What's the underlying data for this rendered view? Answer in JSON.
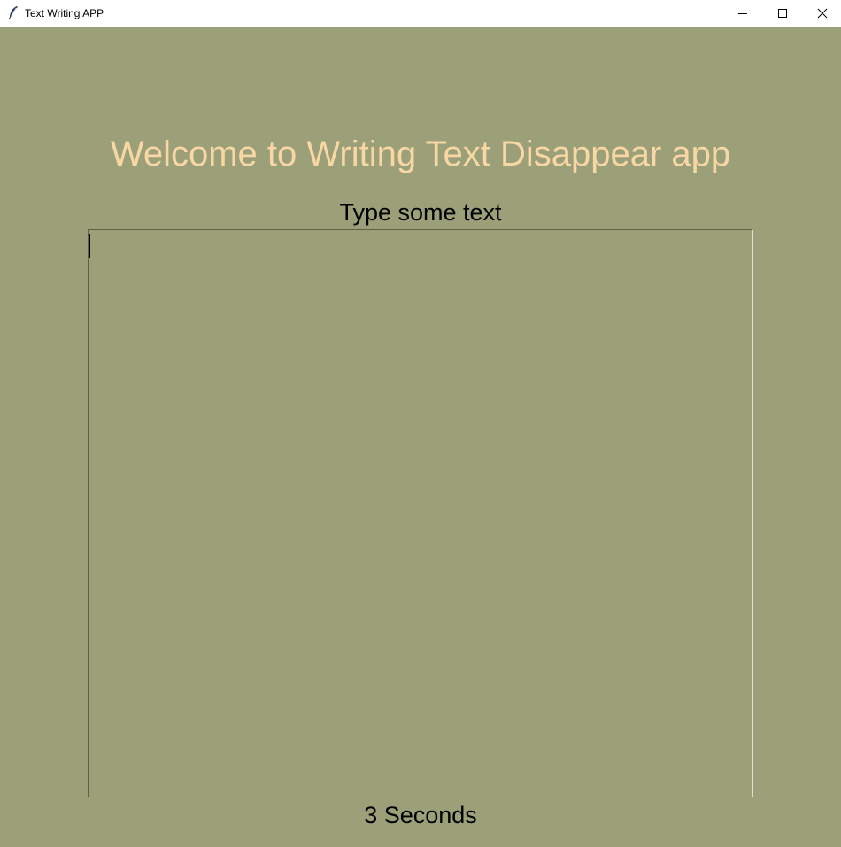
{
  "window": {
    "title": "Text Writing APP",
    "app_icon": "feather-icon",
    "controls": {
      "minimize": "minimize-icon",
      "maximize": "maximize-icon",
      "close": "close-icon"
    }
  },
  "main": {
    "welcome_text": "Welcome to Writing Text Disappear app",
    "prompt_label": "Type some text",
    "text_value": "",
    "timer_label": "3 Seconds"
  },
  "colors": {
    "background": "#9ba079",
    "welcome_text": "#f8d7a5",
    "label_text": "#000000"
  }
}
